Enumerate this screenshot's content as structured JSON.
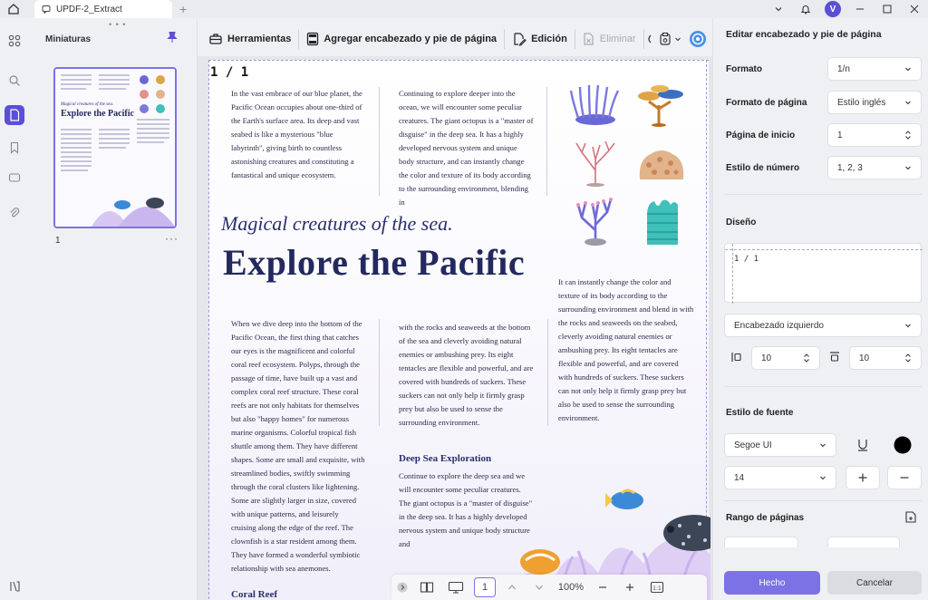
{
  "tab": {
    "title": "UPDF-2_Extract"
  },
  "window": {
    "avatar_letter": "V"
  },
  "thumbnails": {
    "title": "Miniaturas",
    "page_number": "1"
  },
  "toolbar": {
    "tools": "Herramientas",
    "add_header_footer": "Agregar encabezado y pie de página",
    "edit": "Edición",
    "delete": "Eliminar"
  },
  "document": {
    "header_number": "1 / 1",
    "col1": "In the vast embrace of our blue planet, the Pacific Ocean occupies about one-third of the Earth's surface area. Its deep and vast seabed is like a mysterious \"blue labyrinth\", giving birth to countless astonishing creatures and constituting a fantastical and unique ecosystem.",
    "col2": "Continuing to explore deeper into the ocean, we will encounter some peculiar creatures. The giant octopus is a \"master of disguise\" in the deep sea. It has a highly developed nervous system and unique body structure, and can instantly change the color and texture of its body according to the surrounding environment, blending in",
    "subtitle": "Magical creatures of the sea.",
    "title": "Explore the Pacific",
    "col3": "It can instantly change the color and texture of its body according to the surrounding environment and blend in with the rocks and seaweeds on the seabed, cleverly avoiding natural enemies or ambushing prey. Its eight tentacles are flexible and powerful, and are covered with hundreds of suckers. These suckers can not only help it firmly grasp prey but also be used to sense the surrounding environment.",
    "col4": "When we dive deep into the bottom of the Pacific Ocean, the first thing that catches our eyes is the magnificent and colorful coral reef ecosystem. Polyps, through the passage of time, have built up a vast and complex coral reef structure. These coral reefs are not only habitats for themselves but also \"happy homes\" for numerous marine organisms. Colorful tropical fish shuttle among them. They have different shapes. Some are small and exquisite, with streamlined bodies, swiftly swimming through the coral clusters like lightening. Some are slightly larger in size, covered with unique patterns, and leisurely cruising along the edge of the reef. The clownfish is a star resident among them. They have formed a wonderful symbiotic relationship with sea anemones.",
    "col5": "with the rocks and seaweeds at the bottom of the sea and cleverly avoiding natural enemies or ambushing prey. Its eight tentacles are flexible and powerful, and are covered with hundreds of suckers. These suckers can not only help it firmly grasp prey but also be used to sense the surrounding environment.",
    "deep_sea_heading": "Deep Sea Exploration",
    "col6": "Continue to explore the deep sea and we will encounter some peculiar creatures. The giant octopus is a \"master of disguise\" in the deep sea. It has a highly developed nervous system and unique body structure and",
    "coral_reef_heading": "Coral Reef"
  },
  "pagebar": {
    "current_page": "1",
    "zoom": "100%"
  },
  "panel": {
    "title": "Editar encabezado y pie de página",
    "format_label": "Formato",
    "format_value": "1/n",
    "page_format_label": "Formato de página",
    "page_format_value": "Estilo inglés",
    "start_page_label": "Página de inicio",
    "start_page_value": "1",
    "number_style_label": "Estilo de número",
    "number_style_value": "1, 2, 3",
    "design_label": "Diseño",
    "preview_text": "1 / 1",
    "position_value": "Encabezado izquierdo",
    "margin_left_value": "10",
    "margin_top_value": "10",
    "font_style_label": "Estilo de fuente",
    "font_value": "Segoe UI",
    "font_size_value": "14",
    "page_range_label": "Rango de páginas",
    "done_label": "Hecho",
    "cancel_label": "Cancelar"
  },
  "colors": {
    "accent": "#7c72e6",
    "brand": "#5b4fd6",
    "title_navy": "#23285e"
  }
}
